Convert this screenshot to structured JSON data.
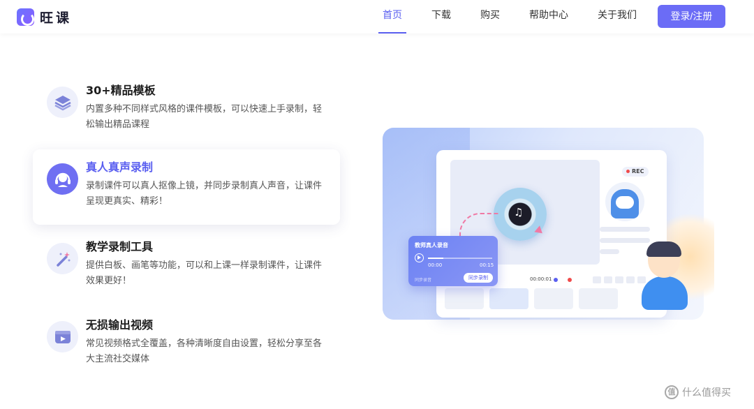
{
  "header": {
    "logo_text": "旺课",
    "nav": [
      "首页",
      "下载",
      "购买",
      "帮助中心",
      "关于我们"
    ],
    "active_nav": "首页",
    "login_label": "登录/注册"
  },
  "features": [
    {
      "title": "30+精品模板",
      "desc": "内置多种不同样式风格的课件模板，可以快速上手录制，轻松输出精品课程",
      "icon": "layers-icon"
    },
    {
      "title": "真人真声录制",
      "desc": "录制课件可以真人抠像上镜，并同步录制真人声音，让课件呈现更真实、精彩！",
      "icon": "headset-icon"
    },
    {
      "title": "教学录制工具",
      "desc": "提供白板、画笔等功能，可以和上课一样录制课件，让课件效果更好！",
      "icon": "magic-wand-icon"
    },
    {
      "title": "无损输出视频",
      "desc": "常见视频格式全覆盖，各种清晰度自由设置，轻松分享至各大主流社交媒体",
      "icon": "video-play-icon"
    }
  ],
  "illustration": {
    "rec_label": "REC",
    "panel_title": "教师真人录音",
    "time_start": "00:00",
    "time_end": "00:15",
    "panel_hint": "同步录音",
    "sync_label": "同步录制",
    "timeline_time": "00:00:01"
  },
  "watermark": {
    "text": "什么值得买",
    "icon_glyph": "值"
  },
  "colors": {
    "accent": "#5a5ff0",
    "button": "#6b6cf6"
  }
}
